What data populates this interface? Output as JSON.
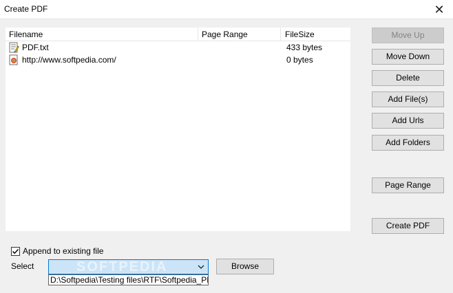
{
  "window": {
    "title": "Create PDF",
    "close_glyph": "✕"
  },
  "file_list": {
    "columns": [
      "Filename",
      "Page Range",
      "FileSize"
    ],
    "rows": [
      {
        "icon": "text-file-icon",
        "filename": "PDF.txt",
        "page_range": "",
        "filesize": "433 bytes"
      },
      {
        "icon": "web-page-icon",
        "filename": "http://www.softpedia.com/",
        "page_range": "",
        "filesize": "0 bytes"
      }
    ]
  },
  "buttons": {
    "move_up": "Move Up",
    "move_down": "Move Down",
    "delete": "Delete",
    "add_files": "Add File(s)",
    "add_urls": "Add Urls",
    "add_folders": "Add Folders",
    "page_range": "Page Range",
    "create_pdf": "Create PDF",
    "browse": "Browse"
  },
  "options": {
    "append_label": "Append to existing file",
    "append_checked": true,
    "select_label": "Select",
    "select_value": "",
    "path_value": "D:\\Softpedia\\Testing files\\RTF\\Softpedia_PDF.p",
    "watermark": "SOFTPEDIA"
  },
  "colors": {
    "combo_focus": "#cce4f7",
    "combo_border": "#0078d7"
  }
}
